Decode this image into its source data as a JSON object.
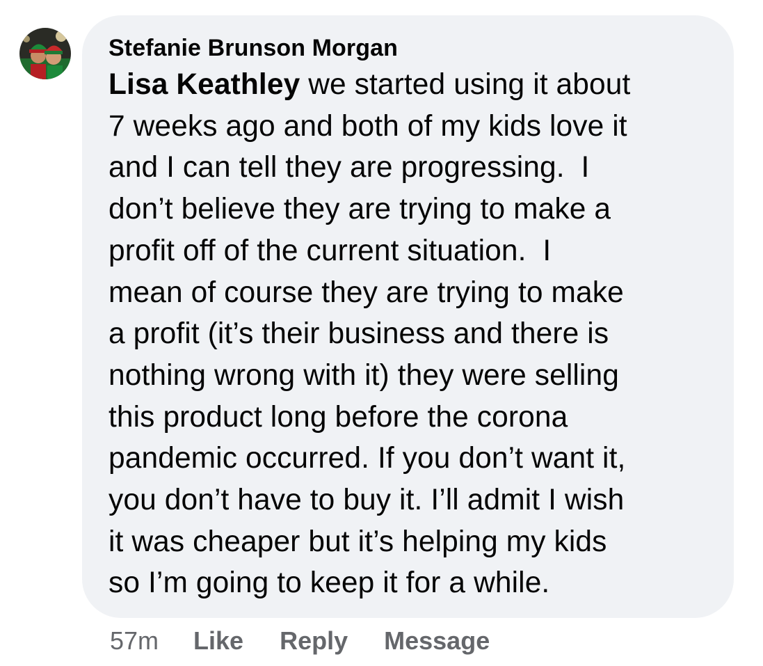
{
  "comment": {
    "author": "Stefanie Brunson Morgan",
    "mention": "Lisa Keathley",
    "first_line_rest": " we started using it about",
    "lines": [
      "7 weeks ago and both of my kids love it",
      "and I can tell they are progressing.  I",
      "don’t believe they are trying to make a",
      "profit off of the current situation.  I",
      "mean of course they are trying to make",
      "a profit (it’s their business and there is",
      "nothing wrong with it) they were selling",
      "this product long before the corona",
      "pandemic occurred. If you don’t want it,",
      "you don’t have to buy it. I’ll admit I wish",
      "it was cheaper but it’s helping my kids",
      "so I’m going to keep it for a while."
    ]
  },
  "actions": {
    "time": "57m",
    "like": "Like",
    "reply": "Reply",
    "message": "Message"
  },
  "colors": {
    "bubble_bg": "#f0f2f5",
    "text": "#050505",
    "secondary_text": "#65676b"
  }
}
